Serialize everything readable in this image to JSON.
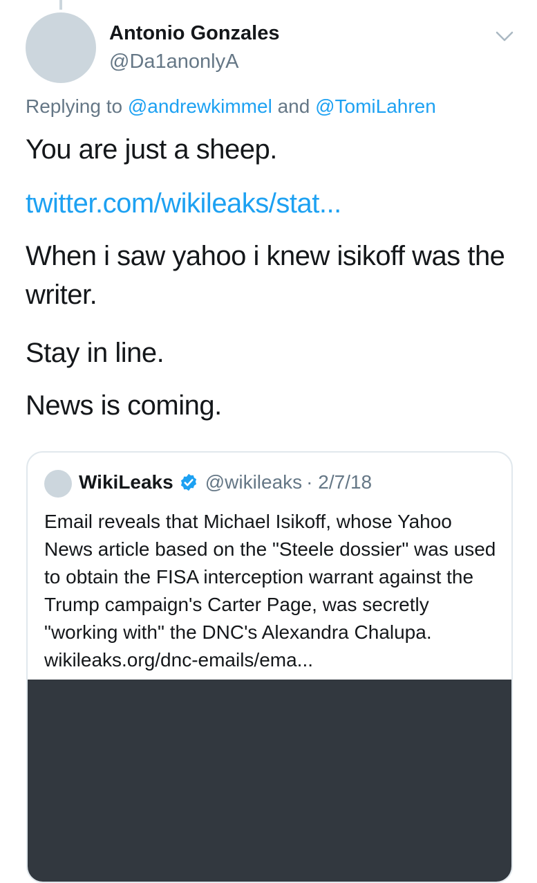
{
  "tweet": {
    "author_name": "Antonio Gonzales",
    "author_handle": "@Da1anonlyA",
    "reply_prefix": "Replying to",
    "reply_mention_1": "@andrewkimmel",
    "reply_and": "and",
    "reply_mention_2": "@TomiLahren",
    "line_1": "You are just a sheep.",
    "link": "twitter.com/wikileaks/stat...",
    "line_2": "When i saw yahoo i knew isikoff was the writer.",
    "line_3": "Stay in line.",
    "line_4": "News is coming."
  },
  "quoted": {
    "name": "WikiLeaks",
    "handle": "@wikileaks",
    "date": "· 2/7/18",
    "text": "Email reveals that Michael Isikoff, whose Yahoo News article based on the \"Steele dossier\" was used to obtain the FISA interception warrant against the Trump campaign's Carter Page, was secretly \"working with\" the DNC's Alexandra Chalupa.",
    "link": "wikileaks.org/dnc-emails/ema..."
  },
  "icons": {
    "menu": "chevron-down-icon",
    "verified": "verified-badge-icon"
  },
  "colors": {
    "link_blue": "#1da1f2",
    "secondary_gray": "#657786",
    "placeholder_gray": "#ccd6dd",
    "media_dark": "#32383f"
  }
}
